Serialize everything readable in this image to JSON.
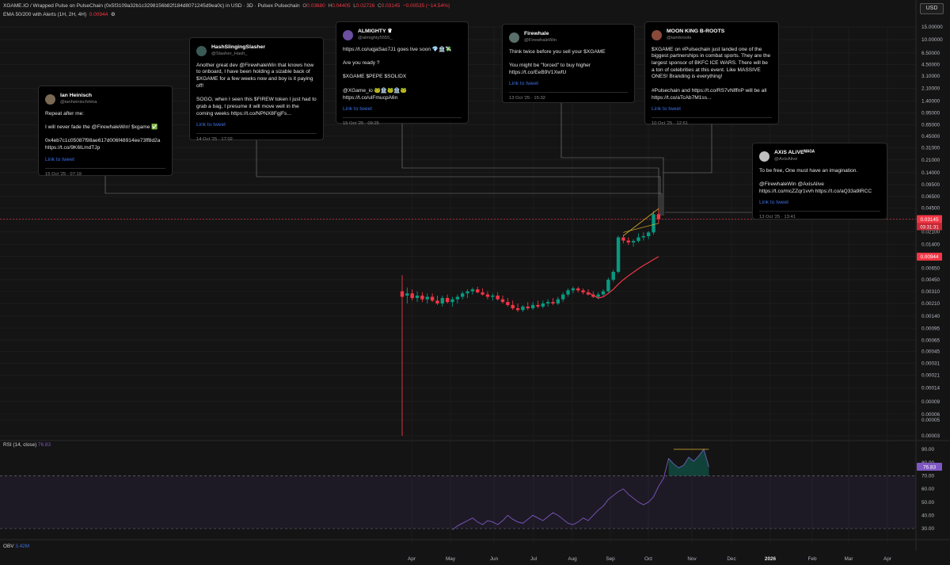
{
  "header": {
    "symbol": "XGAME.IO / Wrapped Pulse on PulseChain (0x5f3109a32b1c3298156b82f184d8071245d9ea0c) in USD · 3D · Pulsex Pulsechain",
    "o_label": "O",
    "o_value": "0.03680",
    "h_label": "H",
    "h_value": "0.04405",
    "l_label": "L",
    "l_value": "0.02726",
    "c_label": "C",
    "c_value": "0.03145",
    "change": "−0.00535 (−14.54%)",
    "ema_label": "EMA 50/200 with Alerts (1H, 2H, 4H)",
    "ema_value": "0.00944",
    "ema_gear": "⚙",
    "currency": "USD"
  },
  "tweets": [
    {
      "name": "Ian Heinisch",
      "handle": "@ianheinischrtma",
      "body": "Repeat after me:\n\nI will never fade the @FirewhaleWin! $xgame ✅\n\n0x4eb7c1c05087f98ae617d006f48914ee73ff8d2a https://t.co/9K6lLmdTJp",
      "link": "Link to tweet",
      "date": "15 Oct '25 · 07:19",
      "avatar_color": "#7a6a55"
    },
    {
      "name": "HashSlingingSlasher",
      "handle": "@Slasher_Hash_",
      "body": "Another great dev @FirewhaleWin that knows how to onboard, I have been holding a sizable back of $XGAME for a few weeks now and boy is it paying off!\n\nSOGO, when I seen this $FIREW token I just had to grab a bag, I presume it will move well in the coming weeks https://t.co/NPNX8FgjFs...",
      "link": "Link to tweet",
      "date": "14 Oct '25 · 17:02",
      "avatar_color": "#3a5a55"
    },
    {
      "name": "ALMIGHTY ♛",
      "handle": "@almighty5555_",
      "body": "https://t.co/uqjaSao7J1 goes live soon 💎🏦💸\n\nAre you ready ?\n\n$XGAME $PEPE $SOLIDX\n\n@XGame_io 🐸🏦🐸🏦🐸\nhttps://t.co/ulFmucpA6n",
      "link": "Link to tweet",
      "date": "15 Oct '25 · 09:25",
      "avatar_color": "#6b4fa0"
    },
    {
      "name": "Firewhale",
      "handle": "@FirewhaleWin",
      "body": "Think twice before you sell your $XGAME\n\nYou might be \"forced\" to buy higher\nhttps://t.co/EeB9V1XwfU",
      "link": "Link to tweet",
      "date": "13 Oct '25 · 15:32",
      "avatar_color": "#5a6e6a"
    },
    {
      "name": "MOON KING B-ROOTS",
      "handle": "@iambroots",
      "body": "$XGAME on #Pulsechain just landed one of the biggest partnerships in combat sports. They are the largest sponsor of BKFC ICE WARS. There will be a ton of celebrities at this event. Like MASSIVE ONES! Branding is everything!\n\n#Pulsechain  and https://t.co/RS7vNlffnP will be all https://t.co/aTcAb7M1ss...",
      "link": "Link to tweet",
      "date": "10 Oct '25 · 12:51",
      "avatar_color": "#8a4a3a"
    },
    {
      "name": "AXiS ALiVEᴹᴬᴳᴬ",
      "handle": "@AxisAlive",
      "body": "To be free, One must have an imagination.\n\n@FirewhaleWin @AxisAlive\nhttps://t.co/mcZZqr1vvh https://t.co/aQ33a9lRCC",
      "link": "Link to tweet",
      "date": "13 Oct '25 · 13:41",
      "avatar_color": "#bfbfbf"
    }
  ],
  "chart_data": [
    {
      "type": "candlestick",
      "title": "XGAME.IO / Wrapped Pulse on PulseChain in USD · 3D · Pulsex Pulsechain",
      "y_scale": "log",
      "y_ticks": [
        "15.00000",
        "10.00000",
        "6.50000",
        "4.50000",
        "3.10000",
        "2.10000",
        "1.40000",
        "0.95000",
        "0.65000",
        "0.45000",
        "0.31000",
        "0.21000",
        "0.14000",
        "0.09500",
        "0.06500",
        "0.04500",
        "0.03100",
        "0.02100",
        "0.01400",
        "0.00950",
        "0.00650",
        "0.00450",
        "0.00310",
        "0.00210",
        "0.00140",
        "0.00095",
        "0.00065",
        "0.00045",
        "0.00031",
        "0.00021",
        "0.00014",
        "0.00009",
        "0.00006",
        "0.00005",
        "0.00003"
      ],
      "x_labels": [
        "Apr",
        "May",
        "Jun",
        "Jul",
        "Aug",
        "Sep",
        "Oct",
        "Nov",
        "Dec",
        "2026",
        "Feb",
        "Mar",
        "Apr"
      ],
      "last_price": "0.03145",
      "countdown": "03:31:31",
      "ema_value": "0.00944",
      "colors": {
        "up": "#089981",
        "down": "#f23645",
        "ema": "#f23645",
        "grid": "#222222",
        "axis_text": "#b2b5be"
      },
      "candles": [
        {
          "t": 0,
          "o": 0.0031,
          "h": 0.0052,
          "l": 3e-05,
          "c": 0.0026
        },
        {
          "t": 1,
          "o": 0.0027,
          "h": 0.0035,
          "l": 0.0021,
          "c": 0.0029
        },
        {
          "t": 2,
          "o": 0.0029,
          "h": 0.0033,
          "l": 0.0023,
          "c": 0.0025
        },
        {
          "t": 3,
          "o": 0.0025,
          "h": 0.0031,
          "l": 0.0022,
          "c": 0.0027
        },
        {
          "t": 4,
          "o": 0.0027,
          "h": 0.003,
          "l": 0.0022,
          "c": 0.0024
        },
        {
          "t": 5,
          "o": 0.0024,
          "h": 0.0029,
          "l": 0.0021,
          "c": 0.0026
        },
        {
          "t": 6,
          "o": 0.0026,
          "h": 0.0029,
          "l": 0.0022,
          "c": 0.0023
        },
        {
          "t": 7,
          "o": 0.0023,
          "h": 0.0027,
          "l": 0.002,
          "c": 0.0021
        },
        {
          "t": 8,
          "o": 0.0021,
          "h": 0.0027,
          "l": 0.0019,
          "c": 0.0025
        },
        {
          "t": 9,
          "o": 0.0025,
          "h": 0.0028,
          "l": 0.0021,
          "c": 0.0022
        },
        {
          "t": 10,
          "o": 0.0022,
          "h": 0.0026,
          "l": 0.0019,
          "c": 0.0024
        },
        {
          "t": 11,
          "o": 0.0024,
          "h": 0.0028,
          "l": 0.0021,
          "c": 0.0026
        },
        {
          "t": 12,
          "o": 0.0026,
          "h": 0.0031,
          "l": 0.0024,
          "c": 0.0029
        },
        {
          "t": 13,
          "o": 0.0029,
          "h": 0.0033,
          "l": 0.0025,
          "c": 0.0031
        },
        {
          "t": 14,
          "o": 0.0031,
          "h": 0.0035,
          "l": 0.0028,
          "c": 0.0033
        },
        {
          "t": 15,
          "o": 0.0033,
          "h": 0.0036,
          "l": 0.0029,
          "c": 0.003
        },
        {
          "t": 16,
          "o": 0.003,
          "h": 0.0034,
          "l": 0.0027,
          "c": 0.0028
        },
        {
          "t": 17,
          "o": 0.0028,
          "h": 0.0031,
          "l": 0.0024,
          "c": 0.0026
        },
        {
          "t": 18,
          "o": 0.0026,
          "h": 0.0029,
          "l": 0.0023,
          "c": 0.0027
        },
        {
          "t": 19,
          "o": 0.0027,
          "h": 0.003,
          "l": 0.0023,
          "c": 0.0024
        },
        {
          "t": 20,
          "o": 0.0024,
          "h": 0.0027,
          "l": 0.0021,
          "c": 0.0022
        },
        {
          "t": 21,
          "o": 0.0022,
          "h": 0.0025,
          "l": 0.0019,
          "c": 0.002
        },
        {
          "t": 22,
          "o": 0.002,
          "h": 0.0023,
          "l": 0.0017,
          "c": 0.0018
        },
        {
          "t": 23,
          "o": 0.0018,
          "h": 0.0021,
          "l": 0.0016,
          "c": 0.0017
        },
        {
          "t": 24,
          "o": 0.0017,
          "h": 0.002,
          "l": 0.0016,
          "c": 0.0019
        },
        {
          "t": 25,
          "o": 0.0019,
          "h": 0.0022,
          "l": 0.0017,
          "c": 0.0018
        },
        {
          "t": 26,
          "o": 0.0018,
          "h": 0.0022,
          "l": 0.0017,
          "c": 0.002
        },
        {
          "t": 27,
          "o": 0.002,
          "h": 0.0023,
          "l": 0.0018,
          "c": 0.0019
        },
        {
          "t": 28,
          "o": 0.0019,
          "h": 0.0023,
          "l": 0.0018,
          "c": 0.0021
        },
        {
          "t": 29,
          "o": 0.0021,
          "h": 0.0024,
          "l": 0.0019,
          "c": 0.0022
        },
        {
          "t": 30,
          "o": 0.0022,
          "h": 0.0025,
          "l": 0.002,
          "c": 0.0021
        },
        {
          "t": 31,
          "o": 0.0021,
          "h": 0.0026,
          "l": 0.002,
          "c": 0.0024
        },
        {
          "t": 32,
          "o": 0.0024,
          "h": 0.003,
          "l": 0.0022,
          "c": 0.0028
        },
        {
          "t": 33,
          "o": 0.0028,
          "h": 0.0034,
          "l": 0.0026,
          "c": 0.0032
        },
        {
          "t": 34,
          "o": 0.0032,
          "h": 0.0036,
          "l": 0.0029,
          "c": 0.0034
        },
        {
          "t": 35,
          "o": 0.0034,
          "h": 0.0036,
          "l": 0.003,
          "c": 0.0032
        },
        {
          "t": 36,
          "o": 0.0032,
          "h": 0.0034,
          "l": 0.0028,
          "c": 0.003
        },
        {
          "t": 37,
          "o": 0.003,
          "h": 0.0033,
          "l": 0.0027,
          "c": 0.0028
        },
        {
          "t": 38,
          "o": 0.0028,
          "h": 0.0031,
          "l": 0.0025,
          "c": 0.0026
        },
        {
          "t": 39,
          "o": 0.0026,
          "h": 0.003,
          "l": 0.0024,
          "c": 0.0028
        },
        {
          "t": 40,
          "o": 0.0028,
          "h": 0.0033,
          "l": 0.0026,
          "c": 0.0031
        },
        {
          "t": 41,
          "o": 0.0031,
          "h": 0.0048,
          "l": 0.003,
          "c": 0.0045
        },
        {
          "t": 42,
          "o": 0.0045,
          "h": 0.0062,
          "l": 0.0042,
          "c": 0.0058
        },
        {
          "t": 43,
          "o": 0.0058,
          "h": 0.0185,
          "l": 0.0055,
          "c": 0.0175
        },
        {
          "t": 44,
          "o": 0.0175,
          "h": 0.019,
          "l": 0.0145,
          "c": 0.0158
        },
        {
          "t": 45,
          "o": 0.0158,
          "h": 0.0175,
          "l": 0.0138,
          "c": 0.0149
        },
        {
          "t": 46,
          "o": 0.0149,
          "h": 0.0165,
          "l": 0.013,
          "c": 0.0156
        },
        {
          "t": 47,
          "o": 0.0156,
          "h": 0.02,
          "l": 0.0148,
          "c": 0.0175
        },
        {
          "t": 48,
          "o": 0.0175,
          "h": 0.0205,
          "l": 0.0158,
          "c": 0.0182
        },
        {
          "t": 49,
          "o": 0.0182,
          "h": 0.0215,
          "l": 0.0165,
          "c": 0.0205
        },
        {
          "t": 50,
          "o": 0.0205,
          "h": 0.041,
          "l": 0.019,
          "c": 0.0368
        },
        {
          "t": 51,
          "o": 0.0368,
          "h": 0.04405,
          "l": 0.02726,
          "c": 0.03145
        }
      ],
      "ema": [
        {
          "t": 37,
          "v": 0.003
        },
        {
          "t": 38,
          "v": 0.0027
        },
        {
          "t": 39,
          "v": 0.0025
        },
        {
          "t": 40,
          "v": 0.0026
        },
        {
          "t": 41,
          "v": 0.0029
        },
        {
          "t": 42,
          "v": 0.0033
        },
        {
          "t": 43,
          "v": 0.0039
        },
        {
          "t": 44,
          "v": 0.0045
        },
        {
          "t": 45,
          "v": 0.0051
        },
        {
          "t": 46,
          "v": 0.0057
        },
        {
          "t": 47,
          "v": 0.0064
        },
        {
          "t": 48,
          "v": 0.0071
        },
        {
          "t": 49,
          "v": 0.0078
        },
        {
          "t": 50,
          "v": 0.0086
        },
        {
          "t": 51,
          "v": 0.00944
        }
      ]
    },
    {
      "type": "line",
      "title": "RSI (14, close)",
      "label": "RSI (14, close)",
      "value": "76.83",
      "y_ticks": [
        "90.00",
        "80.00",
        "70.00",
        "60.00",
        "50.00",
        "40.00",
        "30.00"
      ],
      "overbought": 70,
      "oversold": 30,
      "ylim": [
        20,
        95
      ],
      "values": [
        {
          "t": 0,
          "v": 29
        },
        {
          "t": 1,
          "v": 32
        },
        {
          "t": 2,
          "v": 34
        },
        {
          "t": 3,
          "v": 36
        },
        {
          "t": 4,
          "v": 38
        },
        {
          "t": 5,
          "v": 35
        },
        {
          "t": 6,
          "v": 33
        },
        {
          "t": 7,
          "v": 36
        },
        {
          "t": 8,
          "v": 35
        },
        {
          "t": 9,
          "v": 33
        },
        {
          "t": 10,
          "v": 36
        },
        {
          "t": 11,
          "v": 40
        },
        {
          "t": 12,
          "v": 37
        },
        {
          "t": 13,
          "v": 35
        },
        {
          "t": 14,
          "v": 34
        },
        {
          "t": 15,
          "v": 37
        },
        {
          "t": 16,
          "v": 40
        },
        {
          "t": 17,
          "v": 38
        },
        {
          "t": 18,
          "v": 36
        },
        {
          "t": 19,
          "v": 39
        },
        {
          "t": 20,
          "v": 42
        },
        {
          "t": 21,
          "v": 40
        },
        {
          "t": 22,
          "v": 37
        },
        {
          "t": 23,
          "v": 34
        },
        {
          "t": 24,
          "v": 33
        },
        {
          "t": 25,
          "v": 35
        },
        {
          "t": 26,
          "v": 38
        },
        {
          "t": 27,
          "v": 36
        },
        {
          "t": 28,
          "v": 40
        },
        {
          "t": 29,
          "v": 44
        },
        {
          "t": 30,
          "v": 47
        },
        {
          "t": 31,
          "v": 52
        },
        {
          "t": 32,
          "v": 55
        },
        {
          "t": 33,
          "v": 58
        },
        {
          "t": 34,
          "v": 60
        },
        {
          "t": 35,
          "v": 56
        },
        {
          "t": 36,
          "v": 53
        },
        {
          "t": 37,
          "v": 50
        },
        {
          "t": 38,
          "v": 48
        },
        {
          "t": 39,
          "v": 50
        },
        {
          "t": 40,
          "v": 54
        },
        {
          "t": 41,
          "v": 62
        },
        {
          "t": 42,
          "v": 68
        },
        {
          "t": 43,
          "v": 83
        },
        {
          "t": 44,
          "v": 79
        },
        {
          "t": 45,
          "v": 76
        },
        {
          "t": 46,
          "v": 78
        },
        {
          "t": 47,
          "v": 84
        },
        {
          "t": 48,
          "v": 81
        },
        {
          "t": 49,
          "v": 85
        },
        {
          "t": 50,
          "v": 90
        },
        {
          "t": 51,
          "v": 76.83
        }
      ]
    },
    {
      "type": "line",
      "title": "OBV",
      "label": "OBV",
      "value": "3.42M"
    }
  ]
}
